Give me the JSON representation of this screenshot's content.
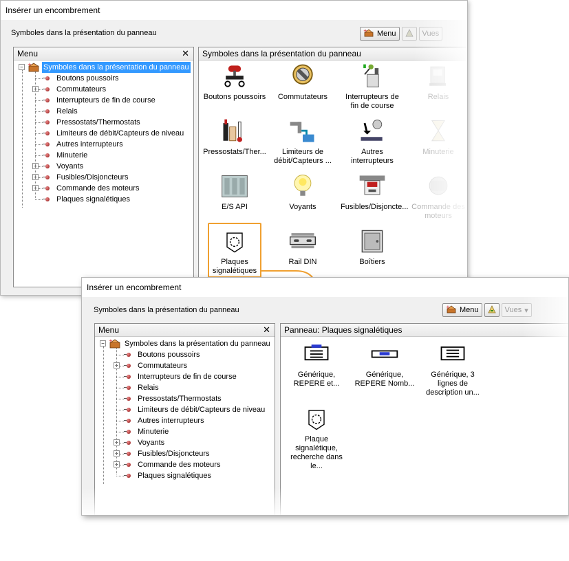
{
  "win1": {
    "title": "Insérer un encombrement",
    "subtitle": "Symboles dans la présentation du panneau",
    "toolbar": {
      "menu_label": "Menu",
      "vues_label": "Vues"
    },
    "menu_panel": {
      "header": "Menu"
    },
    "tree": {
      "root": "Symboles dans la présentation du panneau",
      "items": [
        {
          "label": "Boutons poussoirs",
          "expandable": false
        },
        {
          "label": "Commutateurs",
          "expandable": true
        },
        {
          "label": "Interrupteurs de fin de course",
          "expandable": false
        },
        {
          "label": "Relais",
          "expandable": false
        },
        {
          "label": "Pressostats/Thermostats",
          "expandable": false
        },
        {
          "label": "Limiteurs de débit/Capteurs de niveau",
          "expandable": false
        },
        {
          "label": "Autres interrupteurs",
          "expandable": false
        },
        {
          "label": "Minuterie",
          "expandable": false
        },
        {
          "label": "Voyants",
          "expandable": true
        },
        {
          "label": "Fusibles/Disjoncteurs",
          "expandable": true
        },
        {
          "label": "Commande des moteurs",
          "expandable": true
        },
        {
          "label": "Plaques signalétiques",
          "expandable": false
        }
      ]
    },
    "right_panel": {
      "header": "Symboles dans la présentation du panneau"
    },
    "symbols": [
      {
        "label": "Boutons poussoirs",
        "icon": "push-button-icon"
      },
      {
        "label": "Commutateurs",
        "icon": "selector-switch-icon"
      },
      {
        "label": "Interrupteurs de fin de course",
        "icon": "limit-switch-icon"
      },
      {
        "label": "Relais",
        "icon": "relay-icon"
      },
      {
        "label": "Pressostats/Ther...",
        "icon": "pressure-switch-icon"
      },
      {
        "label": "Limiteurs de débit/Capteurs ...",
        "icon": "flow-switch-icon"
      },
      {
        "label": "Autres interrupteurs",
        "icon": "other-switch-icon"
      },
      {
        "label": "Minuterie",
        "icon": "timer-icon"
      },
      {
        "label": "E/S API",
        "icon": "plc-io-icon"
      },
      {
        "label": "Voyants",
        "icon": "pilot-light-icon"
      },
      {
        "label": "Fusibles/Disjoncte...",
        "icon": "fuse-icon"
      },
      {
        "label": "Commande des moteurs",
        "icon": "motor-control-icon"
      },
      {
        "label": "Plaques signalétiques",
        "icon": "nameplate-icon"
      },
      {
        "label": "Rail DIN",
        "icon": "din-rail-icon"
      },
      {
        "label": "Boîtiers",
        "icon": "enclosure-icon"
      }
    ]
  },
  "win2": {
    "title": "Insérer un encombrement",
    "subtitle": "Symboles dans la présentation du panneau",
    "toolbar": {
      "menu_label": "Menu",
      "vues_label": "Vues"
    },
    "menu_panel": {
      "header": "Menu"
    },
    "right_panel": {
      "header": "Panneau: Plaques signalétiques"
    },
    "nameplates": [
      {
        "label": "Générique, REPERE et...",
        "icon": "nameplate-generic-icon"
      },
      {
        "label": "Générique, REPERE Nomb...",
        "icon": "nameplate-horizontal-icon"
      },
      {
        "label": "Générique, 3 lignes de description un...",
        "icon": "nameplate-3lines-icon"
      },
      {
        "label": "Plaque signalétique, recherche dans le...",
        "icon": "nameplate-lookup-icon"
      }
    ]
  },
  "colors": {
    "accent_orange": "#f0a030",
    "selection_blue": "#3399ff"
  }
}
